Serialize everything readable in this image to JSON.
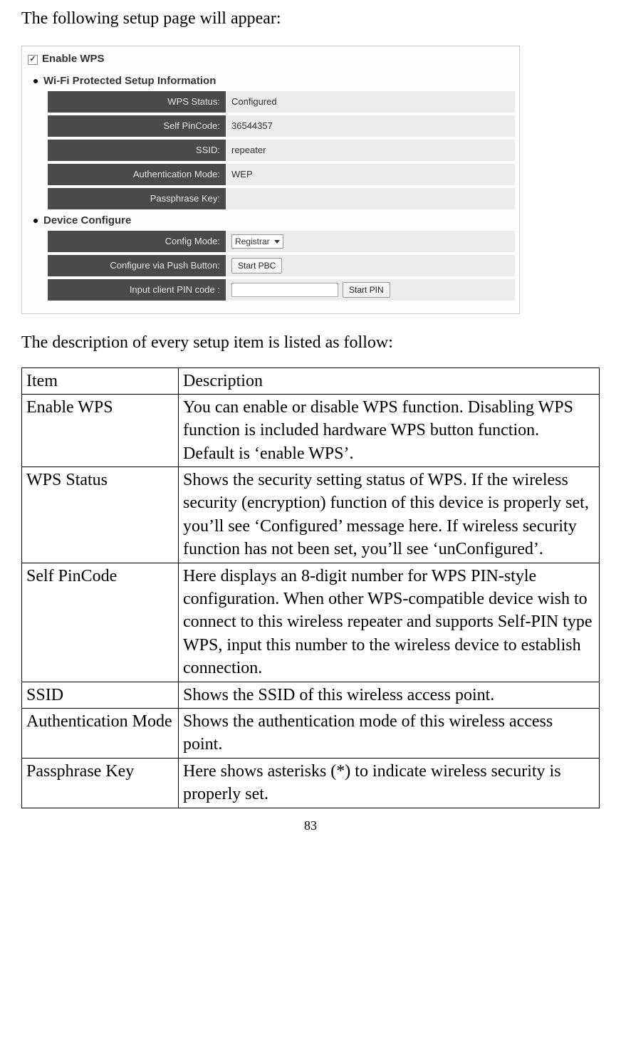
{
  "intro1": "The following setup page will appear:",
  "intro2": "The description of every setup item is listed as follow:",
  "page_number": "83",
  "screenshot": {
    "enable_label": "Enable WPS",
    "enable_checked": true,
    "section1": "Wi-Fi Protected Setup Information",
    "section2": "Device Configure",
    "rows1": [
      {
        "label": "WPS Status:",
        "value": "Configured"
      },
      {
        "label": "Self PinCode:",
        "value": "36544357"
      },
      {
        "label": "SSID:",
        "value": "repeater"
      },
      {
        "label": "Authentication Mode:",
        "value": "WEP"
      },
      {
        "label": "Passphrase Key:",
        "value": ""
      }
    ],
    "config_mode_label": "Config Mode:",
    "config_mode_value": "Registrar",
    "push_button_label": "Configure via Push Button:",
    "push_button_btn": "Start PBC",
    "pin_label": "Input client PIN code :",
    "pin_btn": "Start PIN"
  },
  "table": {
    "head_item": "Item",
    "head_desc": "Description",
    "rows": [
      {
        "item": "Enable WPS",
        "desc": "You can enable or disable WPS function. Disabling WPS function is included hardware WPS button function.\nDefault is ‘enable WPS’."
      },
      {
        "item": "WPS Status",
        "desc": "Shows the security setting status of WPS. If the wireless security (encryption) function of this device is properly set, you’ll see ‘Configured’ message here. If wireless security function has not been set, you’ll see ‘unConfigured’."
      },
      {
        "item": "Self PinCode",
        "desc": "Here displays an 8-digit number for WPS PIN-style configuration. When other WPS-compatible device wish to connect to this wireless repeater and supports Self-PIN type WPS, input this number to the wireless device to establish connection."
      },
      {
        "item": "SSID",
        "desc": "Shows the SSID of this wireless access point."
      },
      {
        "item": "Authentication Mode",
        "desc": "Shows the authentication mode of this wireless access point."
      },
      {
        "item": "Passphrase Key",
        "desc": "Here shows asterisks (*) to indicate wireless security is properly set."
      }
    ]
  }
}
